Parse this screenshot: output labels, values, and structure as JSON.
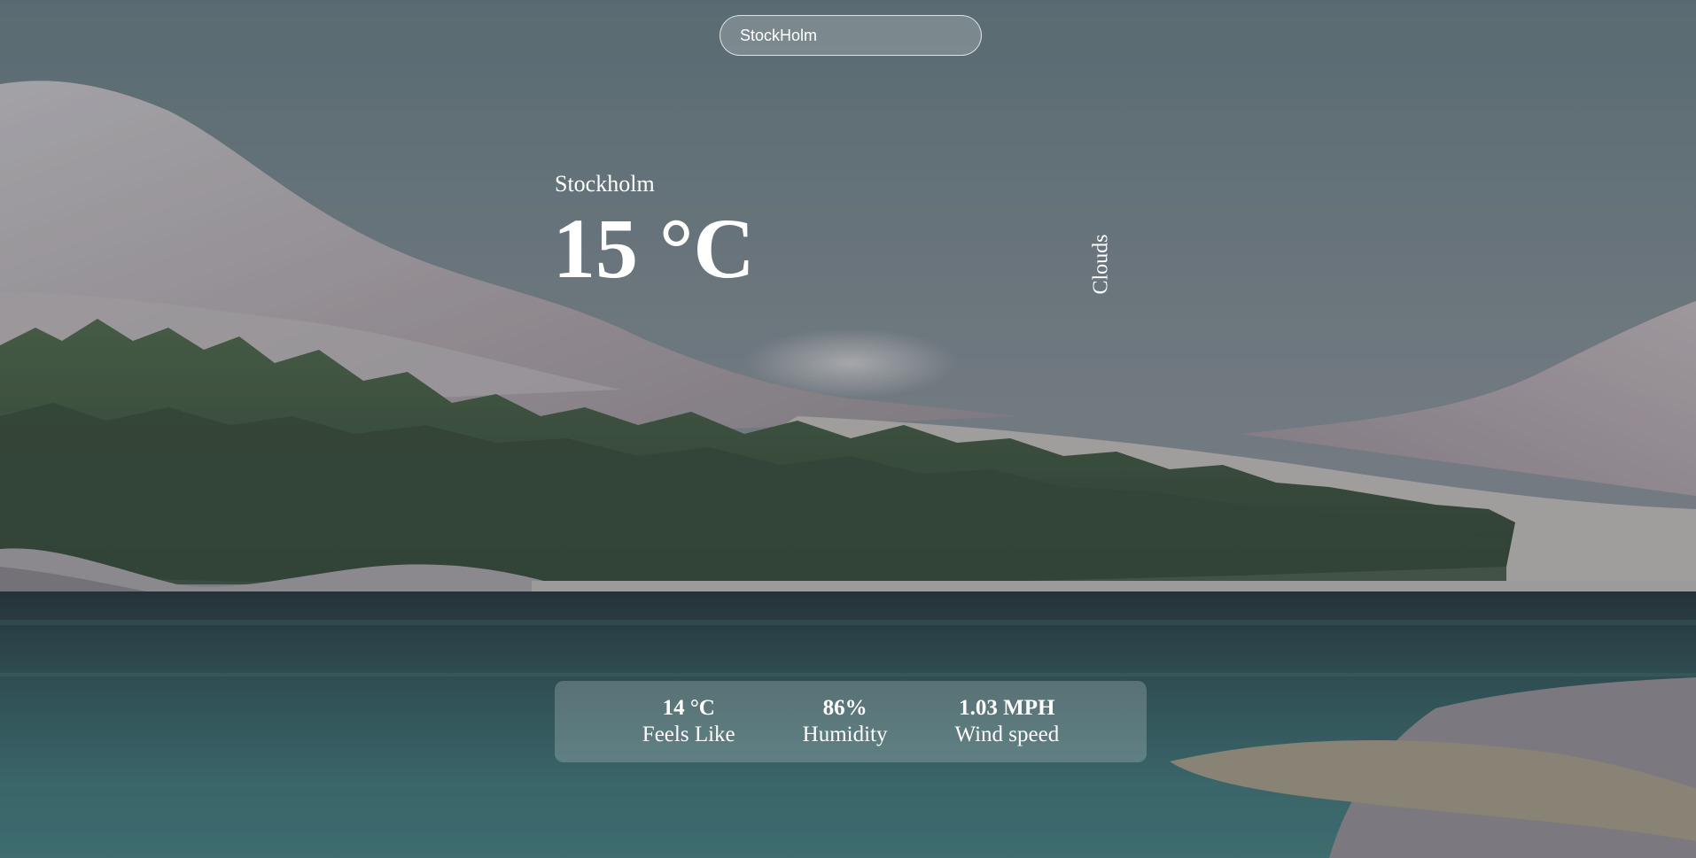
{
  "search": {
    "value": "StockHolm",
    "placeholder": ""
  },
  "weather": {
    "city": "Stockholm",
    "temperature": "15 °C",
    "condition": "Clouds"
  },
  "details": [
    {
      "value": "14 °C",
      "label": "Feels Like"
    },
    {
      "value": "86%",
      "label": "Humidity"
    },
    {
      "value": "1.03 MPH",
      "label": "Wind speed"
    }
  ],
  "colors": {
    "sky": "#6d8189",
    "mountain": "#c9b8bb",
    "forest": "#33492a",
    "lake": "#2f6a6c",
    "panel": "rgba(255,255,255,0.2)"
  }
}
